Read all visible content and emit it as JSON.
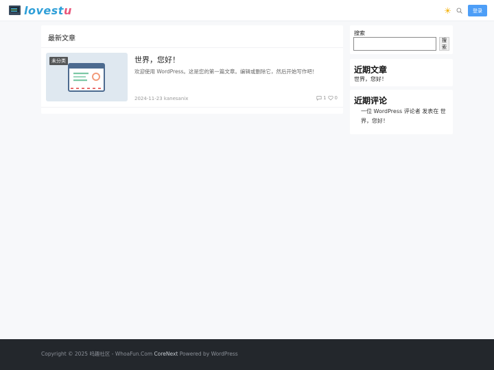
{
  "header": {
    "logo_text_main": "lovest",
    "logo_text_tail": "u",
    "login_label": "登录",
    "theme_icon": "sun-icon",
    "search_icon": "search-icon",
    "accent_color": "#4d9ef7"
  },
  "main": {
    "section_title": "最新文章",
    "posts": [
      {
        "category": "未分类",
        "title": "世界，您好！",
        "excerpt": "欢迎使用 WordPress。这是您的第一篇文章。编辑或删除它，然后开始写作吧！",
        "date": "2024-11-23",
        "author": "kanesanix",
        "comments": "1",
        "likes": "0"
      }
    ]
  },
  "sidebar": {
    "search": {
      "label": "搜索",
      "button_label": "搜索",
      "input_value": ""
    },
    "recent_posts": {
      "title": "近期文章",
      "items": [
        "世界，您好！"
      ]
    },
    "recent_comments": {
      "title": "近期评论",
      "text": "一位 WordPress 评论者 发表在 世界，您好！"
    }
  },
  "footer": {
    "prefix": "Copyright © 2025 呜趣社区 - WhoaFun.Com ",
    "theme_name": "CoreNext",
    "suffix": " Powered by WordPress"
  }
}
